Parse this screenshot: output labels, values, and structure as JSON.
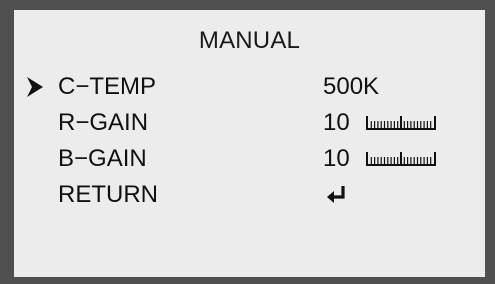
{
  "menu": {
    "title": "MANUAL",
    "items": [
      {
        "label": "C−TEMP",
        "value": "500K",
        "selected": true
      },
      {
        "label": "R−GAIN",
        "value": "10",
        "level": 0.5
      },
      {
        "label": "B−GAIN",
        "value": "10",
        "level": 0.5
      },
      {
        "label": "RETURN",
        "icon": "return-arrow-icon"
      }
    ]
  },
  "colors": {
    "frame": "#505050",
    "background": "#ececec",
    "text": "#111111"
  }
}
